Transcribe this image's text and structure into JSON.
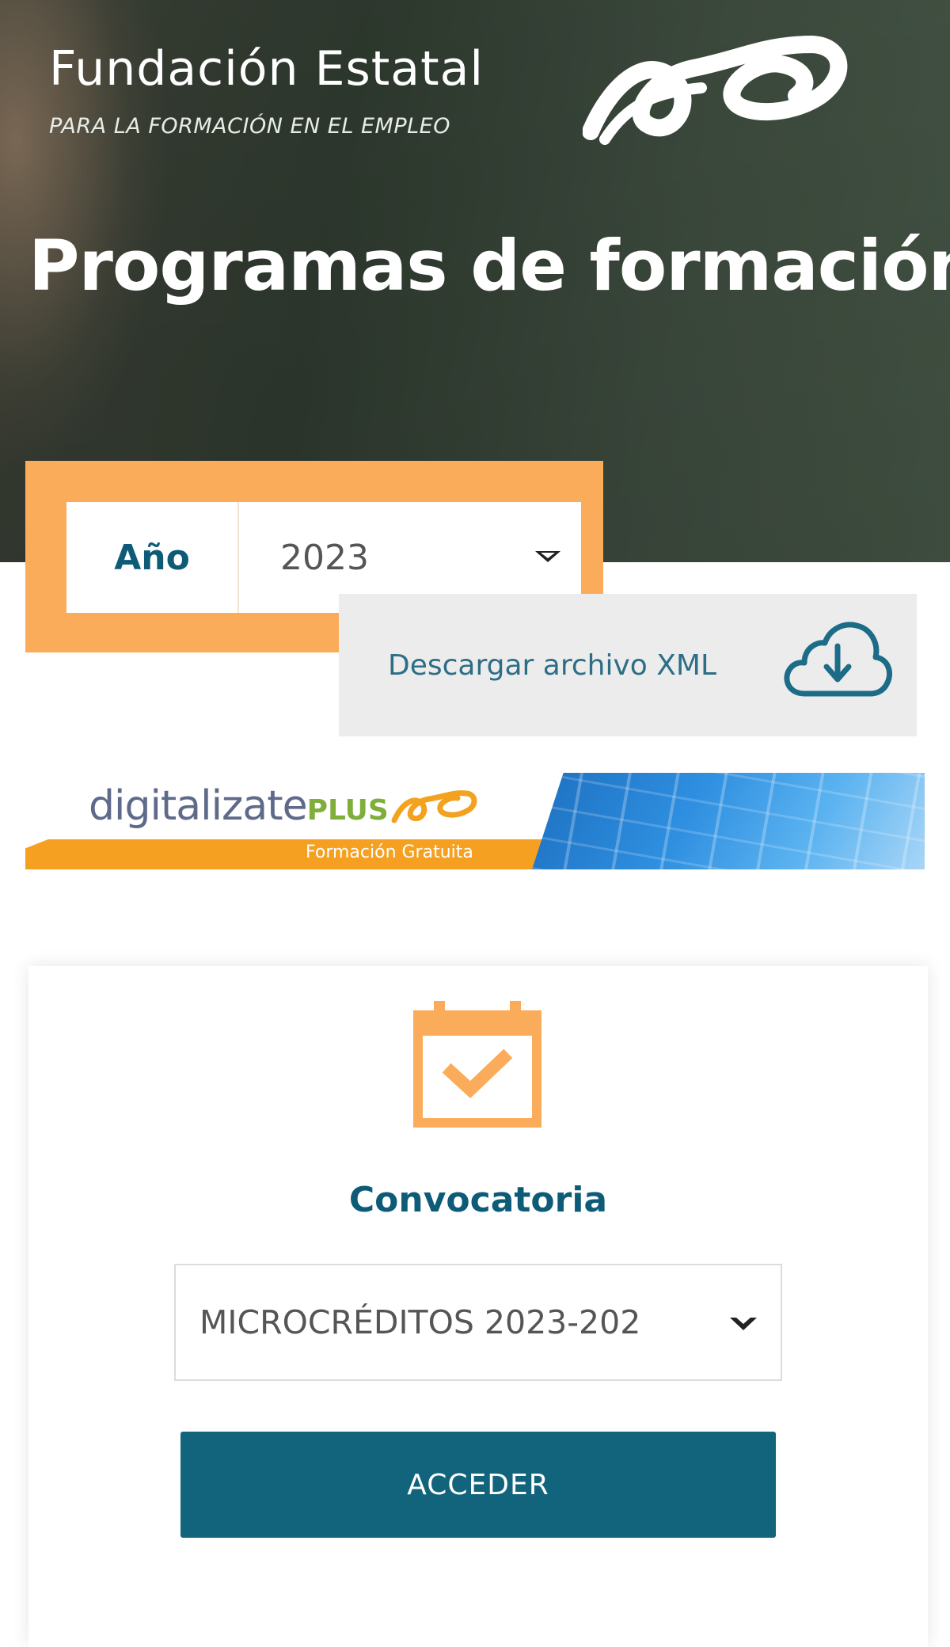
{
  "header": {
    "brand_name": "Fundación Estatal",
    "brand_tagline": "PARA LA FORMACIÓN EN EL EMPLEO",
    "page_title": "Programas de formación"
  },
  "year_filter": {
    "label": "Año",
    "selected_value": "2023"
  },
  "download": {
    "label": "Descargar archivo XML",
    "icon": "cloud-download-icon"
  },
  "banner": {
    "text_main": "digitalizate",
    "text_plus": "PLUS",
    "subtitle": "Formación Gratuita"
  },
  "card": {
    "icon": "calendar-check-icon",
    "title": "Convocatoria",
    "select_value": "MICROCRÉDITOS 2023-202",
    "button_label": "ACCEDER"
  },
  "colors": {
    "accent_orange": "#fbac5b",
    "primary_teal": "#12637c",
    "heading_blue": "#0e5b77"
  }
}
